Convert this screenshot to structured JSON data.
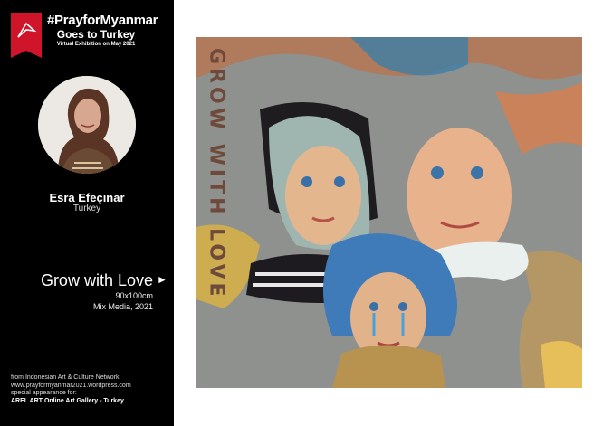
{
  "header": {
    "title_line1": "#PrayforMyanmar",
    "title_line2": "Goes to Turkey",
    "subtitle": "Virtual Exhibition on May 2021"
  },
  "artist": {
    "name": "Esra Efeçınar",
    "country": "Turkey"
  },
  "artwork": {
    "title": "Grow with Love",
    "play_glyph": "►",
    "size": "90x100cm",
    "medium": "Mix Media, 2021",
    "painted_text": "GROW WITH LOVE"
  },
  "footer": {
    "line1": "from Indonesian Art & Culture Network",
    "line2": "www.prayformyanmar2021.wordpress.com",
    "line3": "special appearance for:",
    "line4": "AREL ART Online Art Gallery - Turkey"
  },
  "colors": {
    "sidebar": "#000000",
    "brand_red": "#d0152b",
    "page": "#ffffff"
  },
  "icons": {
    "logo": "prayer-logo-icon",
    "play": "play-icon"
  }
}
